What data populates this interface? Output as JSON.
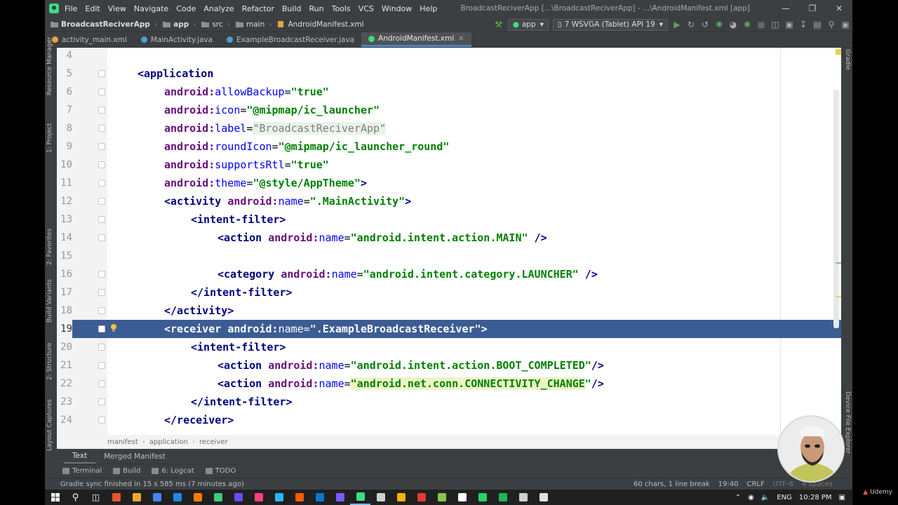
{
  "menubar": {
    "items": [
      "File",
      "Edit",
      "View",
      "Navigate",
      "Code",
      "Analyze",
      "Refactor",
      "Build",
      "Run",
      "Tools",
      "VCS",
      "Window",
      "Help"
    ],
    "title": "BroadcastReciverApp [...\\BroadcastReciverApp] - ...\\AndroidManifest.xml [app]"
  },
  "navbar": {
    "crumbs": [
      "BroadcastReciverApp",
      "app",
      "src",
      "main",
      "AndroidManifest.xml"
    ],
    "run_config": "app",
    "device": "7 WSVGA (Tablet) API 19"
  },
  "tabs": [
    {
      "label": "activity_main.xml",
      "color": "#e8a33d"
    },
    {
      "label": "MainActivity.java",
      "color": "#4a9fd5"
    },
    {
      "label": "ExampleBroadcastReceiver.java",
      "color": "#4a9fd5"
    },
    {
      "label": "AndroidManifest.xml",
      "color": "#e8a33d"
    }
  ],
  "left_tool_windows": [
    "Resource Manager",
    "1: Project",
    "2: Favorites",
    "Build Variants",
    "2: Structure",
    "Layout Captures"
  ],
  "right_tool_windows": [
    "Gradle",
    "Device File Explorer"
  ],
  "editor": {
    "highlighted_line": "19",
    "lines": [
      {
        "num": "4",
        "indent": 0,
        "tokens": []
      },
      {
        "num": "5",
        "indent": 0,
        "tokens": [
          [
            "t",
            "<application"
          ]
        ]
      },
      {
        "num": "6",
        "indent": 1,
        "tokens": [
          [
            "a",
            "android:"
          ],
          [
            "an",
            "allowBackup"
          ],
          [
            "p",
            "="
          ],
          [
            "v",
            "\"true\""
          ]
        ]
      },
      {
        "num": "7",
        "indent": 1,
        "tokens": [
          [
            "a",
            "android:"
          ],
          [
            "an",
            "icon"
          ],
          [
            "p",
            "="
          ],
          [
            "v",
            "\"@mipmap/ic_launcher\""
          ]
        ]
      },
      {
        "num": "8",
        "indent": 1,
        "tokens": [
          [
            "a",
            "android:"
          ],
          [
            "an",
            "label"
          ],
          [
            "p",
            "="
          ],
          [
            "vl",
            "\"BroadcastReciverApp\""
          ]
        ]
      },
      {
        "num": "9",
        "indent": 1,
        "tokens": [
          [
            "a",
            "android:"
          ],
          [
            "an",
            "roundIcon"
          ],
          [
            "p",
            "="
          ],
          [
            "v",
            "\"@mipmap/ic_launcher_round\""
          ]
        ]
      },
      {
        "num": "10",
        "indent": 1,
        "tokens": [
          [
            "a",
            "android:"
          ],
          [
            "an",
            "supportsRtl"
          ],
          [
            "p",
            "="
          ],
          [
            "v",
            "\"true\""
          ]
        ]
      },
      {
        "num": "11",
        "indent": 1,
        "tokens": [
          [
            "a",
            "android:"
          ],
          [
            "an",
            "theme"
          ],
          [
            "p",
            "="
          ],
          [
            "v",
            "\"@style/AppTheme\""
          ],
          [
            "t",
            ">"
          ]
        ]
      },
      {
        "num": "12",
        "indent": 1,
        "tokens": [
          [
            "t",
            "<activity "
          ],
          [
            "a",
            "android:"
          ],
          [
            "an",
            "name"
          ],
          [
            "p",
            "="
          ],
          [
            "v",
            "\".MainActivity\""
          ],
          [
            "t",
            ">"
          ]
        ]
      },
      {
        "num": "13",
        "indent": 2,
        "tokens": [
          [
            "t",
            "<intent-filter>"
          ]
        ]
      },
      {
        "num": "14",
        "indent": 3,
        "tokens": [
          [
            "t",
            "<action "
          ],
          [
            "a",
            "android:"
          ],
          [
            "an",
            "name"
          ],
          [
            "p",
            "="
          ],
          [
            "v",
            "\"android.intent.action.MAIN\""
          ],
          [
            "t",
            " />"
          ]
        ]
      },
      {
        "num": "15",
        "indent": 0,
        "tokens": []
      },
      {
        "num": "16",
        "indent": 3,
        "tokens": [
          [
            "t",
            "<category "
          ],
          [
            "a",
            "android:"
          ],
          [
            "an",
            "name"
          ],
          [
            "p",
            "="
          ],
          [
            "v",
            "\"android.intent.category.LAUNCHER\""
          ],
          [
            "t",
            " />"
          ]
        ]
      },
      {
        "num": "17",
        "indent": 2,
        "tokens": [
          [
            "t",
            "</intent-filter>"
          ]
        ]
      },
      {
        "num": "18",
        "indent": 1,
        "tokens": [
          [
            "t",
            "</activity>"
          ]
        ]
      },
      {
        "num": "19",
        "indent": 1,
        "tokens": [
          [
            "t",
            "<receiver "
          ],
          [
            "a",
            "android:"
          ],
          [
            "an",
            "name"
          ],
          [
            "p",
            "="
          ],
          [
            "v",
            "\".ExampleBroadcastReceiver\""
          ],
          [
            "t",
            ">"
          ]
        ]
      },
      {
        "num": "20",
        "indent": 2,
        "tokens": [
          [
            "t",
            "<intent-filter>"
          ]
        ]
      },
      {
        "num": "21",
        "indent": 3,
        "tokens": [
          [
            "t",
            "<action "
          ],
          [
            "a",
            "android:"
          ],
          [
            "an",
            "name"
          ],
          [
            "p",
            "="
          ],
          [
            "v",
            "\"android.intent.action.BOOT_COMPLETED\""
          ],
          [
            "t",
            "/>"
          ]
        ]
      },
      {
        "num": "22",
        "indent": 3,
        "tokens": [
          [
            "t",
            "<action "
          ],
          [
            "a",
            "android:"
          ],
          [
            "an",
            "name"
          ],
          [
            "p",
            "="
          ],
          [
            "vhi",
            "\"android.net.conn.CONNECTIVITY_CHANGE"
          ],
          [
            "v",
            "\""
          ],
          [
            "t",
            "/>"
          ]
        ]
      },
      {
        "num": "23",
        "indent": 2,
        "tokens": [
          [
            "t",
            "</intent-filter>"
          ]
        ]
      },
      {
        "num": "24",
        "indent": 1,
        "tokens": [
          [
            "t",
            "</receiver>"
          ]
        ]
      }
    ]
  },
  "breadcrumb": [
    "manifest",
    "application",
    "receiver"
  ],
  "bottom_tabs": [
    "Text",
    "Merged Manifest"
  ],
  "tool_windows": [
    "Terminal",
    "Build",
    "6: Logcat",
    "TODO"
  ],
  "status": {
    "message": "Gradle sync finished in 15 s 585 ms (7 minutes ago)",
    "selection": "60 chars, 1 line break",
    "position": "19:40",
    "line_sep": "CRLF",
    "encoding": "UTF-8",
    "indent": "4 spaces"
  },
  "taskbar": {
    "lang": "ENG",
    "time": "10:28 PM",
    "icon_colors": [
      "#e8552b",
      "#f0a732",
      "#4285f4",
      "#1e88e5",
      "#ff7c00",
      "#3dcc7a",
      "#6d4aff",
      "#ff4081",
      "#29b6f6",
      "#ff5a00",
      "#0078d4",
      "#7b5cff",
      "#3ddc84",
      "#cfcfcf",
      "#f4b400",
      "#e53935",
      "#8bc34a",
      "#ffffff",
      "#25d366",
      "#1db954",
      "#cfcfcf",
      "#e0e0e0"
    ]
  },
  "watermark": "Udemy"
}
